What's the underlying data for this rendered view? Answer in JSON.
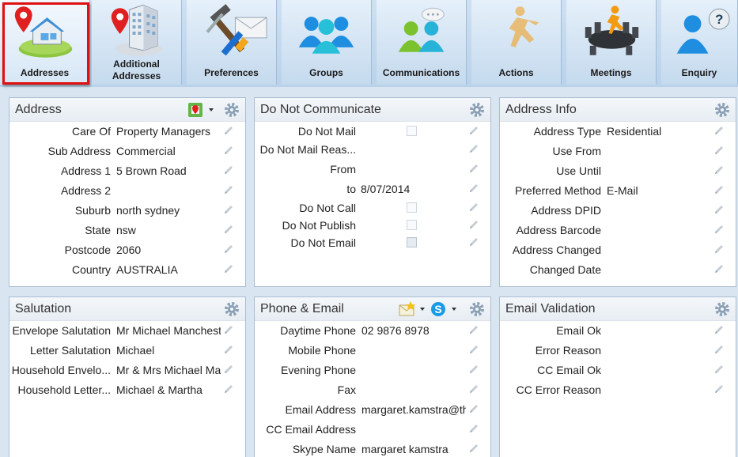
{
  "ribbon": {
    "tabs": [
      {
        "label": "Addresses",
        "icon": "house-pin-icon"
      },
      {
        "label": "Additional\nAddresses",
        "icon": "building-pin-icon"
      },
      {
        "label": "Preferences",
        "icon": "tools-icon"
      },
      {
        "label": "Groups",
        "icon": "people-group-icon"
      },
      {
        "label": "Communications",
        "icon": "chat-people-icon"
      },
      {
        "label": "Actions",
        "icon": "running-man-icon"
      },
      {
        "label": "Meetings",
        "icon": "meeting-table-icon"
      },
      {
        "label": "Enquiry",
        "icon": "question-person-icon"
      }
    ]
  },
  "address": {
    "title": "Address",
    "rows": [
      {
        "label": "Care Of",
        "value": "Property Managers"
      },
      {
        "label": "Sub Address",
        "value": "Commercial"
      },
      {
        "label": "Address 1",
        "value": "5 Brown Road"
      },
      {
        "label": "Address 2",
        "value": ""
      },
      {
        "label": "Suburb",
        "value": "north sydney"
      },
      {
        "label": "State",
        "value": "nsw"
      },
      {
        "label": "Postcode",
        "value": "2060"
      },
      {
        "label": "Country",
        "value": "AUSTRALIA"
      }
    ]
  },
  "dnc": {
    "title": "Do Not Communicate",
    "rows": [
      {
        "label": "Do Not Mail",
        "value": "",
        "kind": "checkbox",
        "checked": false
      },
      {
        "label": "Do Not Mail Reas...",
        "value": "",
        "kind": "text"
      },
      {
        "label": "From",
        "value": "",
        "kind": "text"
      },
      {
        "label": "to",
        "value": "8/07/2014",
        "kind": "text"
      },
      {
        "label": "Do Not Call",
        "value": "",
        "kind": "checkbox",
        "checked": false
      },
      {
        "label": "Do Not Publish",
        "value": "",
        "kind": "checkbox",
        "checked": false
      },
      {
        "label": "Do Not Email",
        "value": "",
        "kind": "checkbox",
        "checked": false,
        "disabled": true
      }
    ]
  },
  "address_info": {
    "title": "Address Info",
    "rows": [
      {
        "label": "Address Type",
        "value": "Residential"
      },
      {
        "label": "Use From",
        "value": ""
      },
      {
        "label": "Use Until",
        "value": ""
      },
      {
        "label": "Preferred Method",
        "value": "E-Mail"
      },
      {
        "label": "Address DPID",
        "value": ""
      },
      {
        "label": "Address Barcode",
        "value": ""
      },
      {
        "label": "Address Changed",
        "value": ""
      },
      {
        "label": "Changed Date",
        "value": ""
      }
    ]
  },
  "salutation": {
    "title": "Salutation",
    "rows": [
      {
        "label": "Envelope Salutation",
        "value": "Mr Michael Manchest"
      },
      {
        "label": "Letter Salutation",
        "value": "Michael"
      },
      {
        "label": "Household Envelo...",
        "value": "Mr & Mrs Michael Ma"
      },
      {
        "label": "Household Letter...",
        "value": "Michael & Martha"
      }
    ]
  },
  "phone": {
    "title": "Phone & Email",
    "rows": [
      {
        "label": "Daytime Phone",
        "value": "02 9876 8978"
      },
      {
        "label": "Mobile Phone",
        "value": ""
      },
      {
        "label": "Evening Phone",
        "value": ""
      },
      {
        "label": "Fax",
        "value": ""
      },
      {
        "label": "Email Address",
        "value": "margaret.kamstra@th"
      },
      {
        "label": "CC Email Address",
        "value": ""
      },
      {
        "label": "Skype Name",
        "value": "margaret kamstra"
      }
    ]
  },
  "email_validation": {
    "title": "Email Validation",
    "rows": [
      {
        "label": "Email Ok",
        "value": ""
      },
      {
        "label": "Error Reason",
        "value": ""
      },
      {
        "label": "CC Email Ok",
        "value": ""
      },
      {
        "label": "CC Error Reason",
        "value": ""
      }
    ]
  },
  "colors": {
    "selected_outline": "#e01010",
    "panel_border": "#a9bdd2",
    "ribbon": "#c5daee"
  }
}
